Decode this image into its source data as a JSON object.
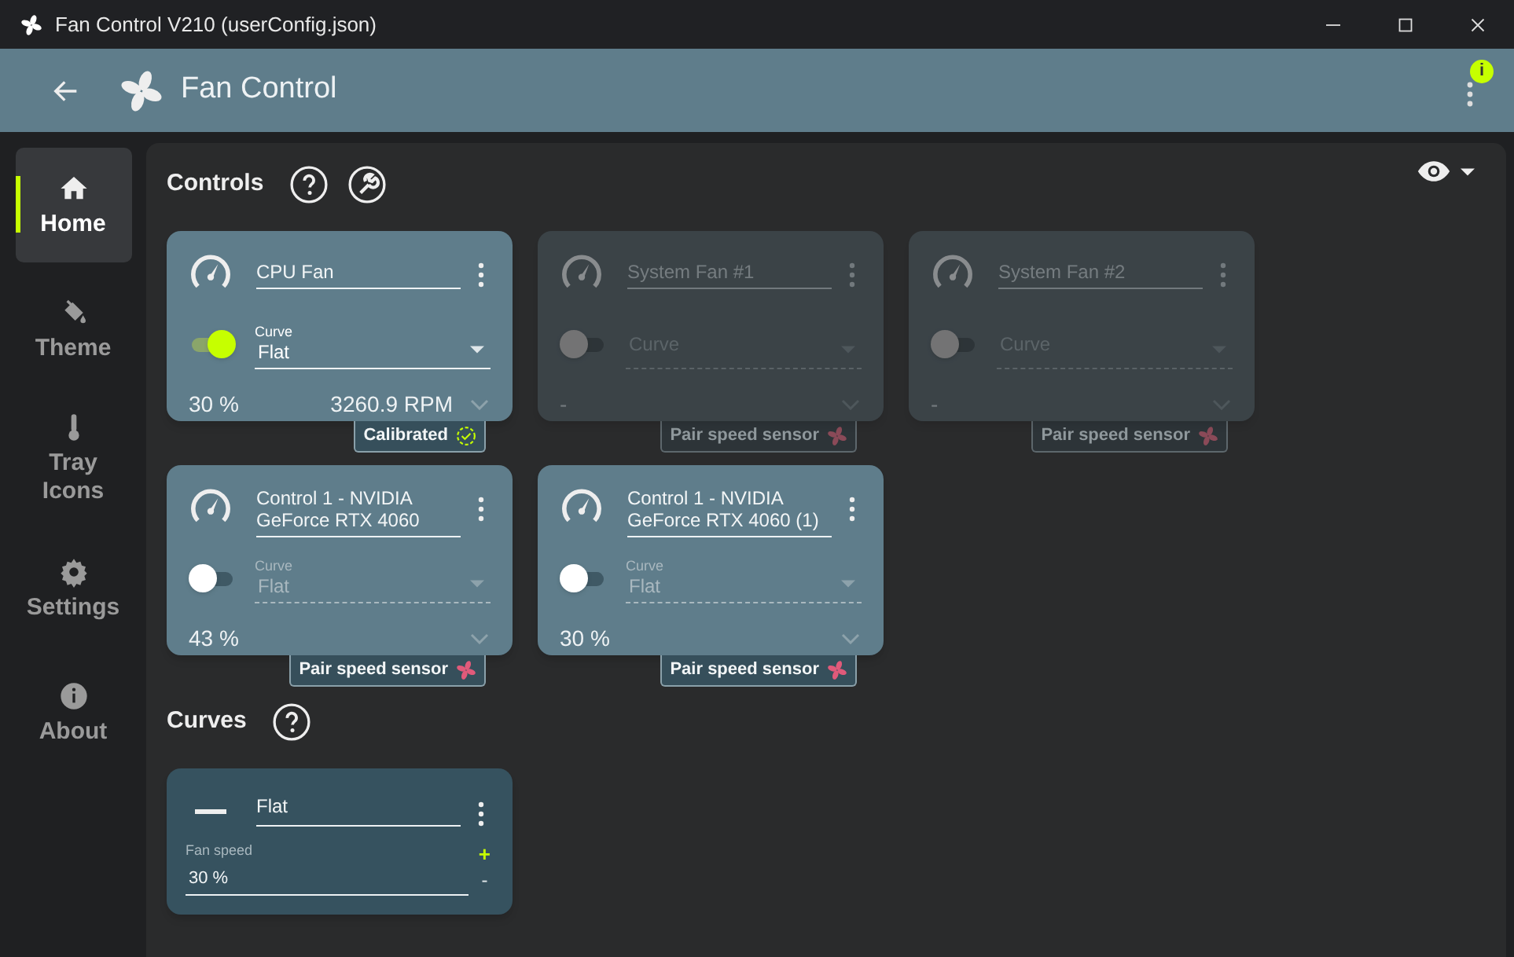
{
  "window": {
    "title": "Fan Control V210 (userConfig.json)"
  },
  "app_bar": {
    "title": "Fan Control",
    "notification": "i"
  },
  "sidebar": {
    "items": [
      {
        "label": "Home",
        "kind": "home",
        "selected": true
      },
      {
        "label": "Theme",
        "kind": "theme",
        "selected": false
      },
      {
        "label": "Tray Icons",
        "kind": "tray",
        "selected": false
      },
      {
        "label": "Settings",
        "kind": "settings",
        "selected": false
      },
      {
        "label": "About",
        "kind": "about",
        "selected": false
      }
    ]
  },
  "controls": {
    "title": "Controls",
    "cards": [
      {
        "name": "CPU Fan",
        "disabled": false,
        "on": true,
        "curve": {
          "label": "Curve",
          "value": "Flat"
        },
        "percent": "30 %",
        "rpm": "3260.9 RPM",
        "badge": {
          "kind": "calibrated",
          "text": "Calibrated"
        }
      },
      {
        "name": "System Fan #1",
        "disabled": true,
        "on": false,
        "curve": {
          "placeholder": "Curve"
        },
        "percent": "-",
        "badge": {
          "kind": "pair",
          "text": "Pair speed sensor"
        }
      },
      {
        "name": "System Fan #2",
        "disabled": true,
        "on": false,
        "curve": {
          "placeholder": "Curve"
        },
        "percent": "-",
        "badge": {
          "kind": "pair",
          "text": "Pair speed sensor"
        }
      },
      {
        "name": "Control 1 - NVIDIA GeForce RTX 4060",
        "disabled": false,
        "on": false,
        "curve": {
          "label": "Curve",
          "value": "Flat"
        },
        "percent": "43 %",
        "badge": {
          "kind": "pair",
          "text": "Pair speed sensor"
        }
      },
      {
        "name": "Control 1 - NVIDIA GeForce RTX 4060 (1)",
        "disabled": false,
        "on": false,
        "curve": {
          "label": "Curve",
          "value": "Flat"
        },
        "percent": "30 %",
        "badge": {
          "kind": "pair",
          "text": "Pair speed sensor"
        }
      }
    ]
  },
  "curves": {
    "title": "Curves",
    "cards": [
      {
        "name": "Flat",
        "field_label": "Fan speed",
        "value": "30 %",
        "plus": "+",
        "minus": "-"
      }
    ]
  }
}
